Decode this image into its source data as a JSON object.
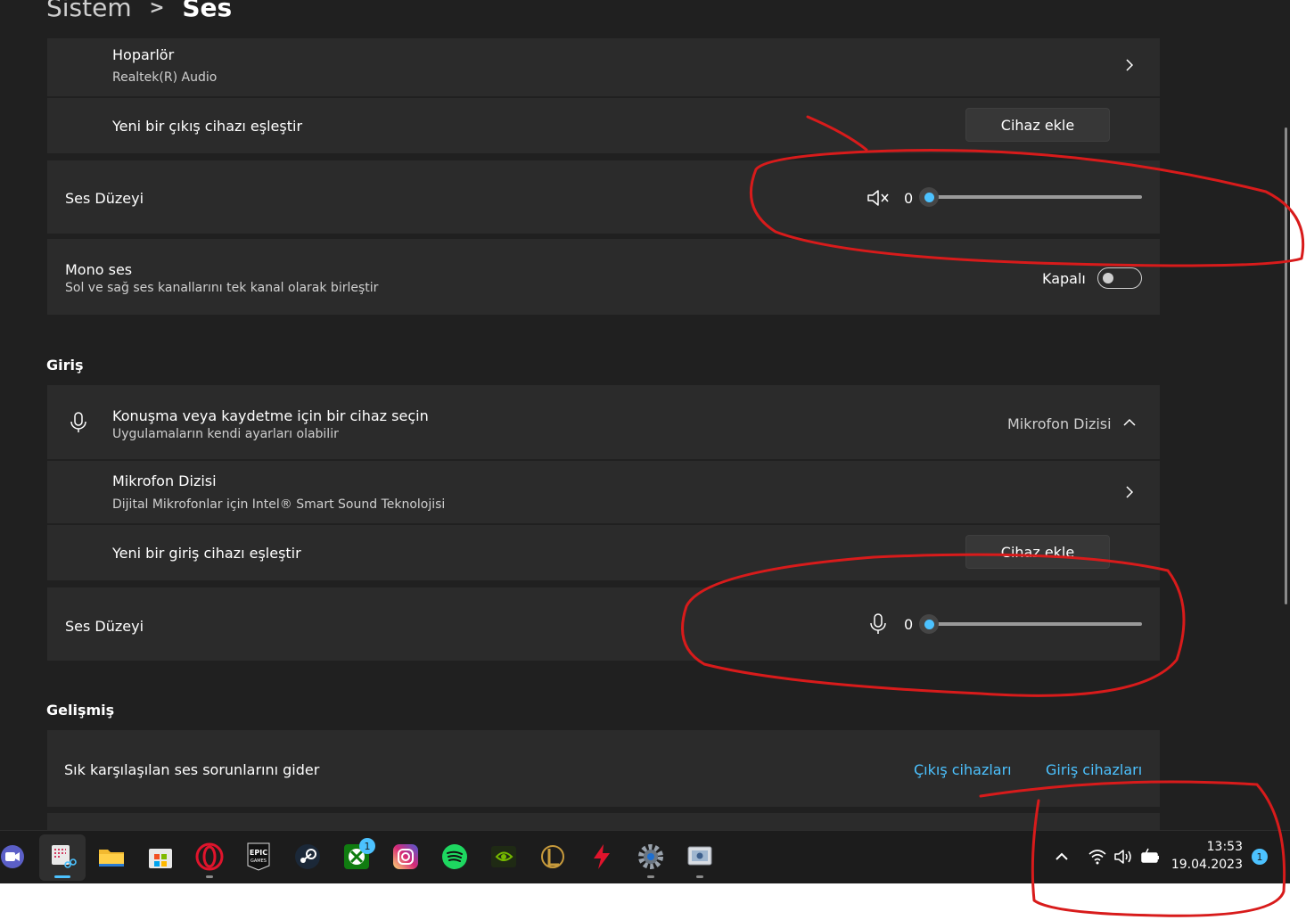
{
  "breadcrumb": {
    "parent": "Sistem",
    "separator": ">",
    "current": "Ses"
  },
  "output": {
    "speaker": {
      "title": "Hoparlör",
      "subtitle": "Realtek(R) Audio"
    },
    "pair": {
      "title": "Yeni bir çıkış cihazı eşleştir",
      "button": "Cihaz ekle"
    },
    "volume": {
      "title": "Ses Düzeyi",
      "value": "0",
      "level": 0,
      "icon": "speaker-muted-icon"
    },
    "mono": {
      "title": "Mono ses",
      "subtitle": "Sol ve sağ ses kanallarını tek kanal olarak birleştir",
      "state": "Kapalı",
      "on": false
    }
  },
  "input": {
    "heading": "Giriş",
    "choose": {
      "title": "Konuşma veya kaydetme için bir cihaz seçin",
      "subtitle": "Uygulamaların kendi ayarları olabilir",
      "selected": "Mikrofon Dizisi"
    },
    "mic": {
      "title": "Mikrofon Dizisi",
      "subtitle": "Dijital Mikrofonlar için Intel® Smart Sound Teknolojisi"
    },
    "pair": {
      "title": "Yeni bir giriş cihazı eşleştir",
      "button": "Cihaz ekle"
    },
    "volume": {
      "title": "Ses Düzeyi",
      "value": "0",
      "level": 0,
      "icon": "microphone-icon"
    }
  },
  "advanced": {
    "heading": "Gelişmiş",
    "troubleshoot": {
      "title": "Sık karşılaşılan ses sorunlarını gider",
      "link_output": "Çıkış cihazları",
      "link_input": "Giriş cihazları"
    }
  },
  "taskbar": {
    "apps": [
      "teams-icon",
      "snipping-tool-icon",
      "file-explorer-icon",
      "microsoft-store-icon",
      "opera-icon",
      "epic-games-icon",
      "steam-icon",
      "xbox-icon",
      "instagram-icon",
      "spotify-icon",
      "nvidia-icon",
      "league-of-legends-icon",
      "lightning-app-icon",
      "settings-icon",
      "control-panel-icon"
    ],
    "epic_label_1": "EPIC",
    "epic_label_2": "GAMES",
    "xbox_badge": "1",
    "time": "13:53",
    "date": "19.04.2023",
    "notification_count": "1"
  },
  "colors": {
    "background": "#202020",
    "card": "#2b2b2b",
    "accent": "#4cc2ff",
    "annotation": "#d81b1b"
  }
}
